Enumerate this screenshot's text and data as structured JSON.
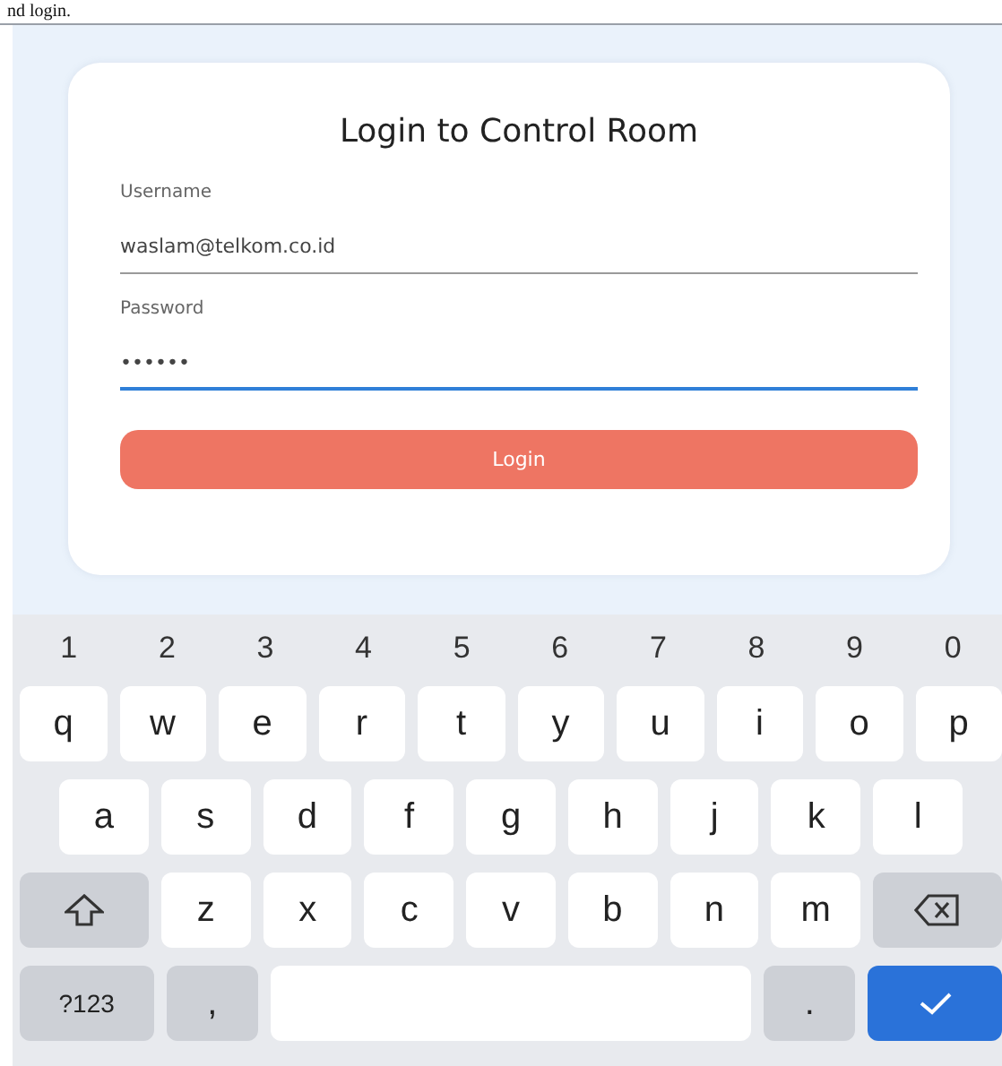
{
  "document_fragment": {
    "text": "nd login."
  },
  "login_card": {
    "title": "Login to Control Room",
    "fields": [
      {
        "label": "Username",
        "value": "waslam@telkom.co.id",
        "focused": false
      },
      {
        "label": "Password",
        "value": "••••••",
        "focused": true
      }
    ],
    "button": "Login"
  },
  "keyboard": {
    "number_row": [
      "1",
      "2",
      "3",
      "4",
      "5",
      "6",
      "7",
      "8",
      "9",
      "0"
    ],
    "rows": [
      [
        {
          "kind": "letter",
          "text": "q"
        },
        {
          "kind": "letter",
          "text": "w"
        },
        {
          "kind": "letter",
          "text": "e"
        },
        {
          "kind": "letter",
          "text": "r"
        },
        {
          "kind": "letter",
          "text": "t"
        },
        {
          "kind": "letter",
          "text": "y"
        },
        {
          "kind": "letter",
          "text": "u"
        },
        {
          "kind": "letter",
          "text": "i"
        },
        {
          "kind": "letter",
          "text": "o"
        },
        {
          "kind": "letter",
          "text": "p"
        }
      ],
      [
        {
          "kind": "letter",
          "text": "a"
        },
        {
          "kind": "letter",
          "text": "s"
        },
        {
          "kind": "letter",
          "text": "d"
        },
        {
          "kind": "letter",
          "text": "f"
        },
        {
          "kind": "letter",
          "text": "g"
        },
        {
          "kind": "letter",
          "text": "h"
        },
        {
          "kind": "letter",
          "text": "j"
        },
        {
          "kind": "letter",
          "text": "k"
        },
        {
          "kind": "letter",
          "text": "l"
        }
      ],
      [
        {
          "kind": "shift"
        },
        {
          "kind": "letter",
          "text": "z"
        },
        {
          "kind": "letter",
          "text": "x"
        },
        {
          "kind": "letter",
          "text": "c"
        },
        {
          "kind": "letter",
          "text": "v"
        },
        {
          "kind": "letter",
          "text": "b"
        },
        {
          "kind": "letter",
          "text": "n"
        },
        {
          "kind": "letter",
          "text": "m"
        },
        {
          "kind": "backspace"
        }
      ],
      [
        {
          "kind": "symbols",
          "text": "?123"
        },
        {
          "kind": "comma",
          "text": ","
        },
        {
          "kind": "space"
        },
        {
          "kind": "period",
          "text": "."
        },
        {
          "kind": "enter"
        }
      ]
    ]
  }
}
